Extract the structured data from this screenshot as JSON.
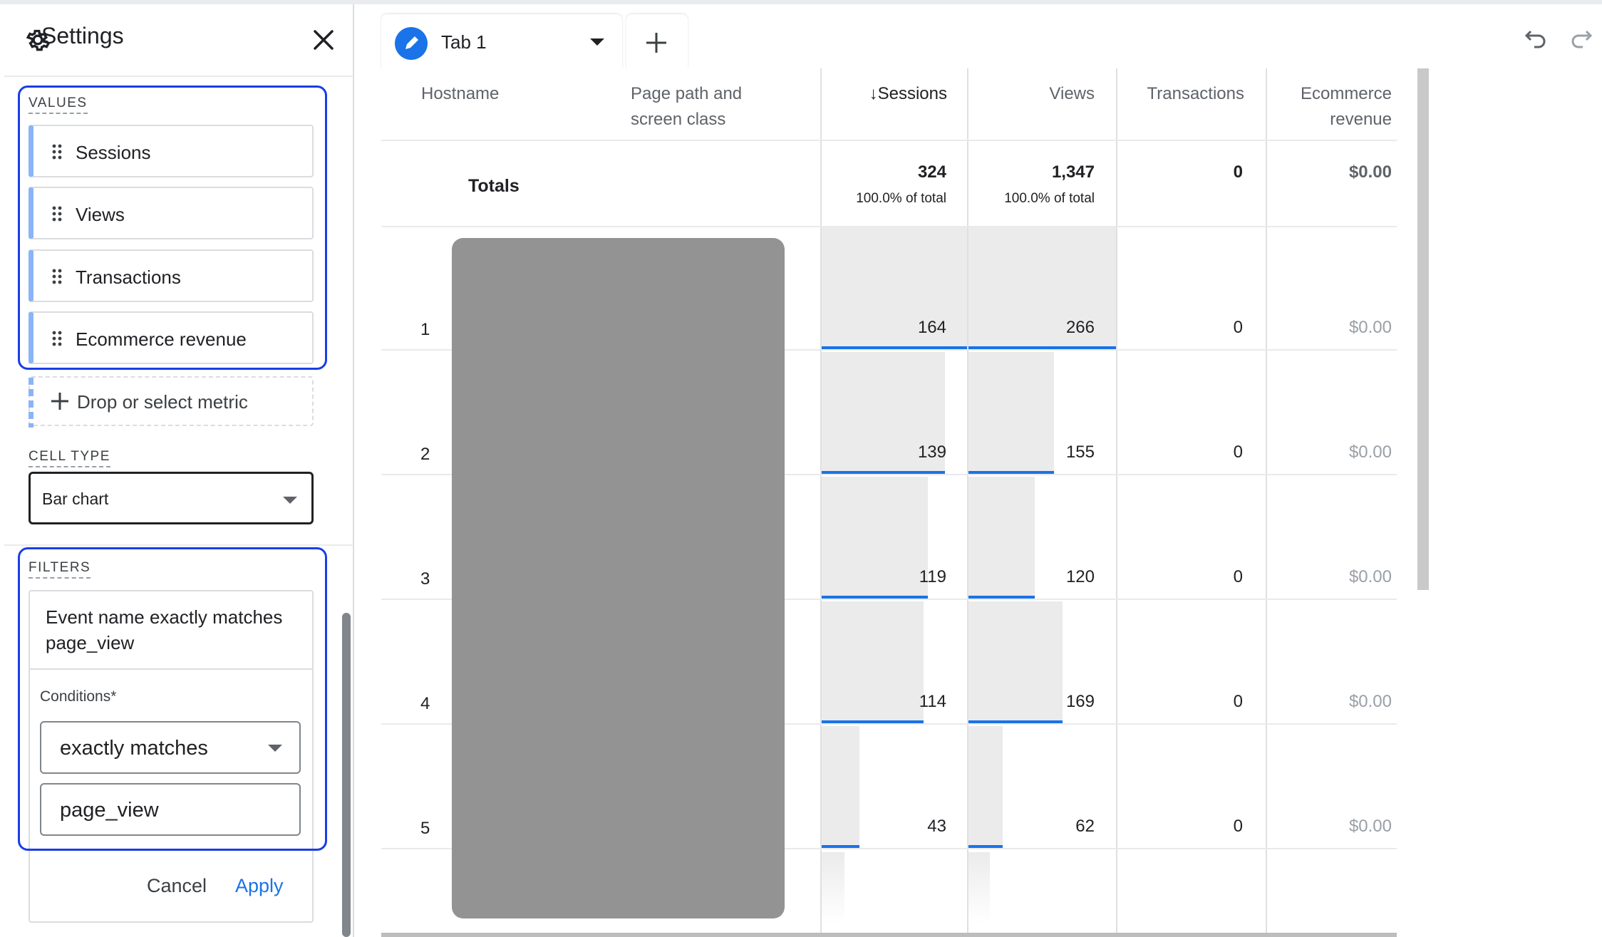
{
  "panel": {
    "title": "Settings",
    "values_label": "VALUES",
    "values": [
      {
        "label": "Sessions"
      },
      {
        "label": "Views"
      },
      {
        "label": "Transactions"
      },
      {
        "label": "Ecommerce revenue"
      }
    ],
    "drop_metric_label": "Drop or select metric",
    "cell_type_label": "CELL TYPE",
    "cell_type_value": "Bar chart",
    "filters_label": "FILTERS",
    "filter_summary": "Event name exactly matches page_view",
    "conditions_label": "Conditions*",
    "condition_operator": "exactly matches",
    "condition_value": "page_view",
    "cancel_label": "Cancel",
    "apply_label": "Apply",
    "highlight_color": "#1a3ee5"
  },
  "tabs": [
    {
      "label": "Tab 1",
      "icon": "pencil-icon"
    }
  ],
  "table": {
    "headers": {
      "hostname": "Hostname",
      "page_path": "Page path and screen class",
      "sessions": "Sessions",
      "views": "Views",
      "transactions": "Transactions",
      "revenue": "Ecommerce revenue"
    },
    "sort_indicator": "↓",
    "totals": {
      "label": "Totals",
      "sessions": "324",
      "sessions_pct": "100.0% of total",
      "views": "1,347",
      "views_pct": "100.0% of total",
      "transactions": "0",
      "revenue": "$0.00"
    },
    "rows": [
      {
        "rank": "1",
        "sessions": "164",
        "sessions_fraction": 1.0,
        "views": "266",
        "views_fraction": 1.0,
        "transactions": "0",
        "revenue": "$0.00"
      },
      {
        "rank": "2",
        "sessions": "139",
        "sessions_fraction": 0.85,
        "views": "155",
        "views_fraction": 0.58,
        "transactions": "0",
        "revenue": "$0.00"
      },
      {
        "rank": "3",
        "sessions": "119",
        "sessions_fraction": 0.73,
        "views": "120",
        "views_fraction": 0.45,
        "transactions": "0",
        "revenue": "$0.00"
      },
      {
        "rank": "4",
        "sessions": "114",
        "sessions_fraction": 0.7,
        "views": "169",
        "views_fraction": 0.64,
        "transactions": "0",
        "revenue": "$0.00"
      },
      {
        "rank": "5",
        "sessions": "43",
        "sessions_fraction": 0.26,
        "views": "62",
        "views_fraction": 0.23,
        "transactions": "0",
        "revenue": "$0.00"
      }
    ],
    "bar_color": "#1a73e8"
  }
}
